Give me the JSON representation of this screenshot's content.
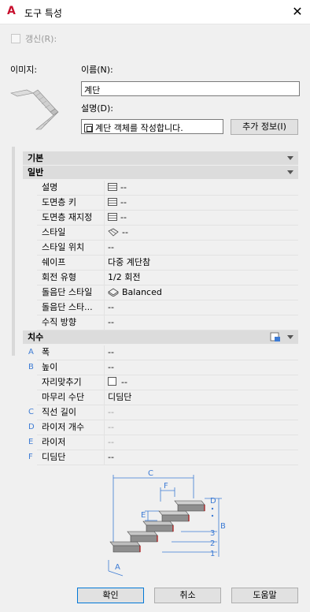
{
  "window": {
    "title": "도구 특성",
    "close_label": "✕",
    "app_icon": "autocad-a-icon"
  },
  "refresh": {
    "label": "갱신(R):",
    "checked": false
  },
  "image_label": "이미지:",
  "name_label": "이름(N):",
  "name_value": "계단",
  "desc_label": "설명(D):",
  "desc_value": "계단 객체를 작성합니다.",
  "more_info_button": "추가 정보(I)",
  "sections": {
    "basic": "기본",
    "general": "일반",
    "dimensions": "치수"
  },
  "general_rows": [
    {
      "key": "설명",
      "value": "--",
      "icon": "list-icon"
    },
    {
      "key": "도면층 키",
      "value": "--",
      "icon": "list-icon"
    },
    {
      "key": "도면층 재지정",
      "value": "--",
      "icon": "list-icon"
    },
    {
      "key": "스타일",
      "value": "--",
      "icon": "stair-style-icon"
    },
    {
      "key": "스타일 위치",
      "value": "--"
    },
    {
      "key": "쉐이프",
      "value": "다중 계단참"
    },
    {
      "key": "회전 유형",
      "value": "1/2 회전"
    },
    {
      "key": "돌음단 스타일",
      "value": "Balanced",
      "icon": "winder-style-icon"
    },
    {
      "key": "돌음단 스타...",
      "value": "--"
    },
    {
      "key": "수직 방향",
      "value": "--"
    }
  ],
  "dimension_rows": [
    {
      "letter": "A",
      "key": "폭",
      "value": "--"
    },
    {
      "letter": "B",
      "key": "높이",
      "value": "--"
    },
    {
      "letter": "",
      "key": "자리맞추기",
      "value": "--",
      "icon": "checkbox-icon"
    },
    {
      "letter": "",
      "key": "마무리 수단",
      "value": "디딤단"
    },
    {
      "letter": "C",
      "key": "직선 길이",
      "value": "--",
      "dim": true
    },
    {
      "letter": "D",
      "key": "라이저 개수",
      "value": "--",
      "dim": true
    },
    {
      "letter": "E",
      "key": "라이저",
      "value": "--",
      "dim": true
    },
    {
      "letter": "F",
      "key": "디딤단",
      "value": "--"
    }
  ],
  "diagram_labels": {
    "c": "C",
    "f": "F",
    "d": "D",
    "e": "E",
    "b": "B",
    "a": "A",
    "n3": "3",
    "n2": "2",
    "n1": "1"
  },
  "buttons": {
    "ok": "확인",
    "cancel": "취소",
    "help": "도움말"
  }
}
